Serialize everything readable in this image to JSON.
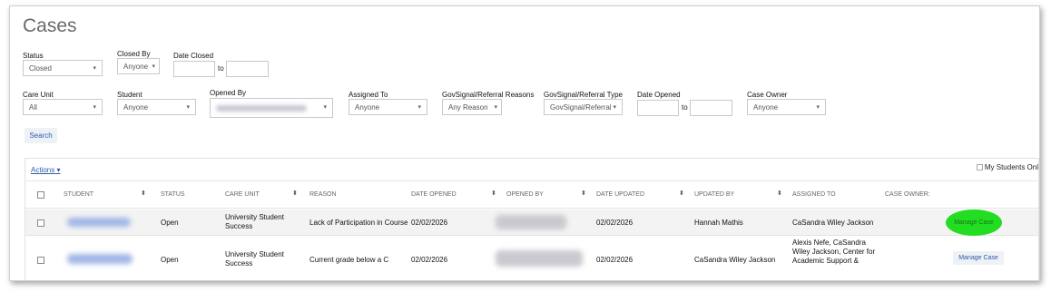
{
  "page": {
    "title": "Cases"
  },
  "filters": {
    "status": {
      "label": "Status",
      "value": "Closed"
    },
    "closed_by": {
      "label": "Closed By",
      "value": "Anyone"
    },
    "date_closed": {
      "label": "Date Closed",
      "to": "to"
    },
    "care_unit": {
      "label": "Care Unit",
      "value": "All"
    },
    "student": {
      "label": "Student",
      "value": "Anyone"
    },
    "opened_by": {
      "label": "Opened By"
    },
    "assigned_to": {
      "label": "Assigned To",
      "value": "Anyone"
    },
    "govsignal_reasons": {
      "label": "GovSignal/Referral Reasons",
      "value": "Any Reason"
    },
    "govsignal_type": {
      "label": "GovSignal/Referral Type",
      "value": "GovSignal/Referral"
    },
    "date_opened": {
      "label": "Date Opened",
      "to": "to"
    },
    "case_owner": {
      "label": "Case Owner",
      "value": "Anyone"
    },
    "search_button": "Search"
  },
  "grid": {
    "actions_label": "Actions",
    "my_students_label": "My Students Onl",
    "columns": [
      "STUDENT",
      "STATUS",
      "CARE UNIT",
      "REASON",
      "DATE OPENED",
      "OPENED BY",
      "DATE UPDATED",
      "UPDATED BY",
      "ASSIGNED TO",
      "CASE OWNER:"
    ],
    "rows": [
      {
        "status": "Open",
        "care_unit": "University Student Success",
        "reason": "Lack of Participation in Course",
        "date_opened": "02/02/2026",
        "date_updated": "02/02/2026",
        "updated_by": "Hannah Mathis",
        "assigned_to": "CaSandra Wiley Jackson",
        "case_owner": "",
        "action": "Manage Case"
      },
      {
        "status": "Open",
        "care_unit": "University Student Success",
        "reason": "Current grade below a C",
        "date_opened": "02/02/2026",
        "date_updated": "02/02/2026",
        "updated_by": "CaSandra Wiley Jackson",
        "assigned_to": "Alexis Nefe, CaSandra Wiley Jackson, Center for Academic Support &",
        "case_owner": "",
        "action": "Manage Case"
      }
    ]
  },
  "colors": {
    "link": "#2d5aa6",
    "highlight": "#22dd22",
    "row_alt": "#f3f3f3"
  },
  "icons": [
    "caret-down-icon",
    "sort-icon",
    "checkbox-icon"
  ]
}
